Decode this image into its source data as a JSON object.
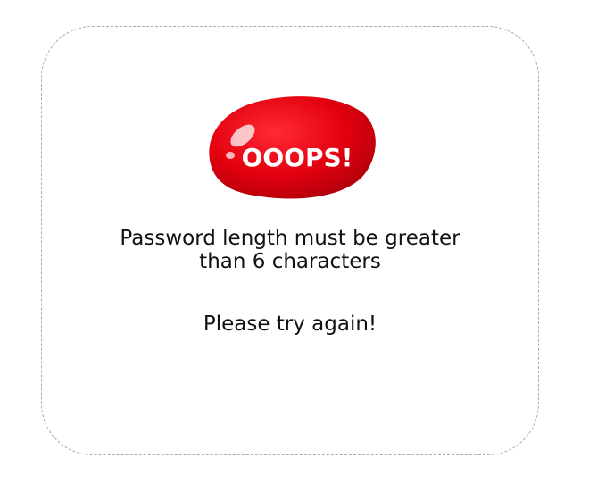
{
  "dialog": {
    "badge_text": "OOOPS!",
    "badge_color": "#e3000f",
    "message_line1": "Password length must be greater",
    "message_line2": "than 6 characters",
    "retry_text": "Please try again!"
  }
}
